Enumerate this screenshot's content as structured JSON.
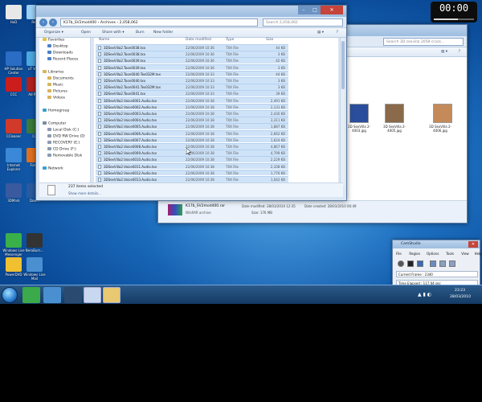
{
  "explorer": {
    "breadcrumb": "K17b_SV2mod400 › Archives › 2,058,062",
    "search_placeholder": "Search 2,058,062",
    "toolbar": {
      "organize": "Organize ▾",
      "open": "Open",
      "share": "Share with ▾",
      "burn": "Burn",
      "new_folder": "New folder"
    },
    "nav": {
      "favorites": "Favorites",
      "desktop": "Desktop",
      "downloads": "Downloads",
      "recent": "Recent Places",
      "libraries": "Libraries",
      "documents": "Documents",
      "music": "Music",
      "pictures": "Pictures",
      "videos": "Videos",
      "homegroup": "Homegroup",
      "computer": "Computer",
      "local_disk": "Local Disk (C:)",
      "dvd": "DVD RW Drive (D:",
      "recovery": "RECOVERY (E:)",
      "cd_drive": "CD Drive (F:)",
      "removable": "Removable Disk",
      "network": "Network"
    },
    "columns": {
      "name": "Name",
      "date": "Date modified",
      "type": "Type",
      "size": "Size"
    },
    "files": [
      {
        "name": "3DSexVilla2.Toon0038.txx",
        "date": "22/06/2009 10:36",
        "type": "TXX File",
        "size": "44 KB"
      },
      {
        "name": "3DSexVilla2.Toon0038.txx",
        "date": "22/06/2009 10:36",
        "type": "TXX File",
        "size": "3 KB"
      },
      {
        "name": "3DSexVilla2.Toon0039.txx",
        "date": "22/06/2009 10:36",
        "type": "TXX File",
        "size": "42 KB"
      },
      {
        "name": "3DSexVilla2.Toon0039.txx",
        "date": "22/06/2009 10:36",
        "type": "TXX File",
        "size": "3 KB"
      },
      {
        "name": "3DSexVilla2.Toon0040.Tex032M.txx",
        "date": "22/06/2009 10:33",
        "type": "TXX File",
        "size": "44 KB"
      },
      {
        "name": "3DSexVilla2.Toon0040.txx",
        "date": "22/06/2009 10:33",
        "type": "TXX File",
        "size": "3 KB"
      },
      {
        "name": "3DSexVilla2.Toon0041.Tex032M.txx",
        "date": "22/06/2009 10:33",
        "type": "TXX File",
        "size": "3 KB"
      },
      {
        "name": "3DSexVilla2.Toon0041.txx",
        "date": "22/06/2009 10:33",
        "type": "TXX File",
        "size": "39 KB"
      },
      {
        "name": "3DSexVilla2.Voice0001.Audio.txx",
        "date": "22/06/2009 10:38",
        "type": "TXX File",
        "size": "2,491 KB"
      },
      {
        "name": "3DSexVilla2.Voice0002.Audio.txx",
        "date": "22/06/2009 10:38",
        "type": "TXX File",
        "size": "2,131 KB"
      },
      {
        "name": "3DSexVilla2.Voice0003.Audio.txx",
        "date": "22/06/2009 10:38",
        "type": "TXX File",
        "size": "2,430 KB"
      },
      {
        "name": "3DSexVilla2.Voice0004.Audio.txx",
        "date": "22/06/2009 10:38",
        "type": "TXX File",
        "size": "3,311 KB"
      },
      {
        "name": "3DSexVilla2.Voice0005.Audio.txx",
        "date": "22/06/2009 10:38",
        "type": "TXX File",
        "size": "1,887 KB"
      },
      {
        "name": "3DSexVilla2.Voice0006.Audio.txx",
        "date": "22/06/2009 10:38",
        "type": "TXX File",
        "size": "2,662 KB"
      },
      {
        "name": "3DSexVilla2.Voice0007.Audio.txx",
        "date": "22/06/2009 10:38",
        "type": "TXX File",
        "size": "1,624 KB"
      },
      {
        "name": "3DSexVilla2.Voice0008.Audio.txx",
        "date": "22/06/2009 10:38",
        "type": "TXX File",
        "size": "4,867 KB"
      },
      {
        "name": "3DSexVilla2.Voice0009.Audio.txx",
        "date": "22/06/2009 10:38",
        "type": "TXX File",
        "size": "4,799 KB"
      },
      {
        "name": "3DSexVilla2.Voice0010.Audio.txx",
        "date": "22/06/2009 10:38",
        "type": "TXX File",
        "size": "2,229 KB"
      },
      {
        "name": "3DSexVilla2.Voice0011.Audio.txx",
        "date": "22/06/2009 10:38",
        "type": "TXX File",
        "size": "2,108 KB"
      },
      {
        "name": "3DSexVilla2.Voice0012.Audio.txx",
        "date": "22/06/2009 10:38",
        "type": "TXX File",
        "size": "1,776 KB"
      },
      {
        "name": "3DSexVilla2.Voice0013.Audio.txx",
        "date": "22/06/2009 10:38",
        "type": "TXX File",
        "size": "1,042 KB"
      }
    ],
    "status_count": "237 items selected",
    "status_more": "Show more details..."
  },
  "bg_explorer": {
    "search_placeholder": "Search 3D sexvilla 2058 crack...",
    "thumbnails": [
      {
        "caption": "3D SexVilla 2-4003.jpg",
        "color": "#2a4e9c"
      },
      {
        "caption": "3D SexVilla 2-4005.jpg",
        "color": "#8a6a4a"
      },
      {
        "caption": "3D SexVilla 2-4006.jpg",
        "color": "#c48a5a"
      }
    ],
    "network_label": "Network",
    "detail_name": "K17b_SV2mod400.rar",
    "detail_date_label": "Date modified: 28/03/2010 12:35",
    "detail_created_label": "Date created: 28/03/2010 00:49",
    "detail_type": "WinRAR archive",
    "detail_size": "Size: 176 MB"
  },
  "desktop_icons": [
    {
      "label": "HxD",
      "color": "#e8e8e8"
    },
    {
      "label": "Rec",
      "color": "#9ad0f5"
    },
    {
      "label": "HP Solution Center",
      "color": "#2b6cc4"
    },
    {
      "label": "uT Ver...",
      "color": "#4da8e0"
    },
    {
      "label": "CCC",
      "color": "#cc1d1d"
    },
    {
      "label": "Ad Re...",
      "color": "#b02020"
    },
    {
      "label": "CCleaner",
      "color": "#d03a2a"
    },
    {
      "label": "Ca",
      "color": "#3a7a3a"
    },
    {
      "label": "Internet Explorer",
      "color": "#3b88d8"
    },
    {
      "label": "Fire...",
      "color": "#e07020"
    },
    {
      "label": "3DMark",
      "color": "#3a5aa0"
    },
    {
      "label": "Dow...",
      "color": "#2a5aa0"
    },
    {
      "label": "Windows Live Messenger",
      "color": "#3ab04a"
    },
    {
      "label": "NeroBurn...",
      "color": "#333333"
    },
    {
      "label": "PowerDVD",
      "color": "#f0c030"
    },
    {
      "label": "Windows Live Mail",
      "color": "#4a90d0"
    }
  ],
  "clock": {
    "time": "00:00",
    "label": ""
  },
  "camstudio": {
    "title": "CamStudio",
    "menu": [
      "File",
      "Region",
      "Options",
      "Tools",
      "View",
      "Help"
    ],
    "current_frame": "Current Frame : 2340",
    "time_elapsed": "Time Elapsed : 117.04 sec"
  },
  "taskbar": {
    "time": "23:23",
    "date": "28/03/2010"
  }
}
